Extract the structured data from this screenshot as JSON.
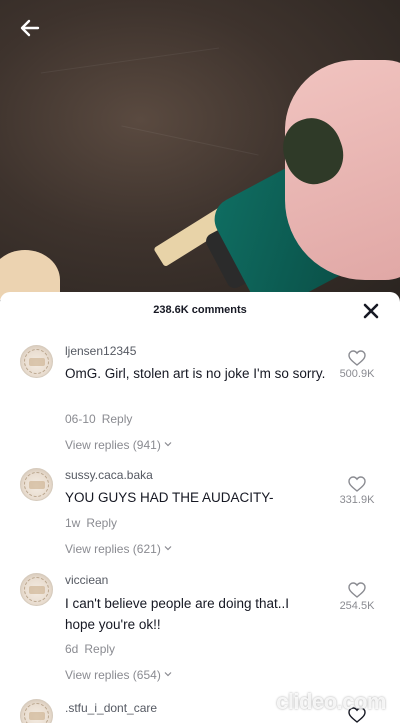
{
  "header": {
    "comments_count": "238.6K comments"
  },
  "comments": [
    {
      "username": "ljensen12345",
      "text": "OmG. Girl, stolen art is no joke I'm so sorry.",
      "date": "06-10",
      "reply_label": "Reply",
      "view_replies": "View replies (941)",
      "likes": "500.9K"
    },
    {
      "username": "sussy.caca.baka",
      "text": "YOU GUYS HAD THE AUDACITY-",
      "date": "1w",
      "reply_label": "Reply",
      "view_replies": "View replies (621)",
      "likes": "331.9K"
    },
    {
      "username": "vicciean",
      "text": "I can't believe people are doing that..I hope you're ok!!",
      "date": "6d",
      "reply_label": "Reply",
      "view_replies": "View replies (654)",
      "likes": "254.5K"
    },
    {
      "username": ".stfu_i_dont_care"
    }
  ],
  "watermark": "clideo.com",
  "colors": {
    "text": "#161823",
    "secondary": "#8a8b91",
    "sheet": "#ffffff"
  }
}
